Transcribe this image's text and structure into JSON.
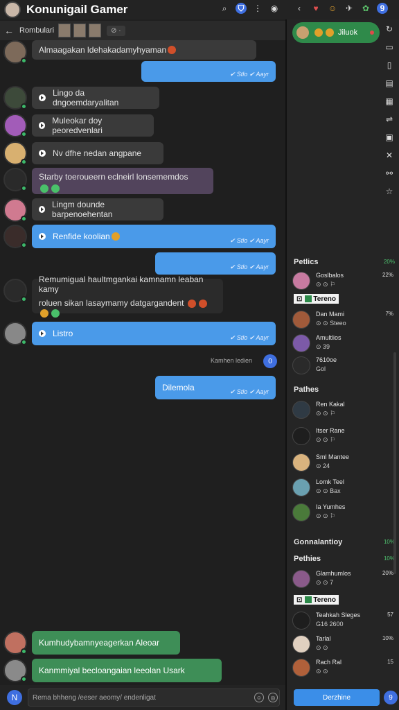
{
  "app": {
    "title": "Konunigail Gamer"
  },
  "topbar_icons": [
    "search-icon",
    "shield-icon",
    "more-icon",
    "profile-icon",
    "back-icon",
    "heart-icon",
    "mask-icon",
    "pin-icon",
    "leaf-icon",
    "badge-icon"
  ],
  "subbar": {
    "back": "←",
    "title": "Rombulari",
    "chip": "⊘ ·"
  },
  "messages": [
    {
      "type": "in",
      "text": "Almaagakan ldehakadamyhyaman"
    },
    {
      "type": "out",
      "text": "",
      "meta": "✔ Stlo  ✔ Aayr"
    },
    {
      "type": "in-voice",
      "text": "Lingo da dngoemdaryalitan"
    },
    {
      "type": "in-voice",
      "text": "Muleokar doy peoredvenlari"
    },
    {
      "type": "in-voice",
      "text": "Nv dfhe  nedan  angpane"
    },
    {
      "type": "in-purple",
      "text": "Starby toeroueern eclneirl  lonsememdos"
    },
    {
      "type": "in-voice",
      "text": "Lingm dounde barpenoehentan"
    },
    {
      "type": "out-voice",
      "text": "Renfide koolian",
      "meta": "✔ Stlo  ✔ Aayr"
    },
    {
      "type": "out",
      "text": "",
      "meta": "✔ Stlo  ✔ Aayr"
    },
    {
      "type": "in-long",
      "line1": "Remumigual haultmgankai kamnamn leaban kamy",
      "line2": "roluen sikan lasaymamy datgargandent"
    },
    {
      "type": "out-voice",
      "text": "Listro",
      "meta": "✔ Stlo  ✔ Aayr"
    },
    {
      "type": "out",
      "text": "Dilemola",
      "meta": "✔ Stlo  ✔ Aayr"
    },
    {
      "type": "in-green",
      "text": "Kumhudybamnyeagerkan  Aleoar"
    },
    {
      "type": "in-green",
      "text": "Kanmmiyal becloangaian  leeolan  Usark"
    }
  ],
  "system": {
    "text": "Kamhen ledien",
    "button": "0"
  },
  "composer": {
    "placeholder": "Rema bhheng /eeser aeomy/ endenligat",
    "plus": "N"
  },
  "right": {
    "active": {
      "label": "Jiluok"
    },
    "sections": [
      {
        "title": "Petlics",
        "count": "20%"
      },
      {
        "title": "Pathes",
        "count": ""
      },
      {
        "title": "Gonnalantioy",
        "count": "10%"
      },
      {
        "title": "Pethies",
        "count": "10%"
      }
    ],
    "members": [
      {
        "name": "Goslbalos",
        "stat": "⊙ ⊙ ⚐",
        "val": "22%"
      },
      {
        "name": "Dan Mami",
        "stat": "⊙ ⊙ Steeo",
        "val": "7%"
      },
      {
        "name": "Amultlios",
        "stat": "⊙ 39",
        "val": ""
      },
      {
        "name": "7610oe",
        "stat": "Gol",
        "val": ""
      },
      {
        "name": "Ren Kakal",
        "stat": "⊙ ⊙ ⚐",
        "val": ""
      },
      {
        "name": "Itser Rane",
        "stat": "⊙ ⊙ ⚐",
        "val": ""
      },
      {
        "name": "Sml Mantee",
        "stat": "⊙ 24",
        "val": ""
      },
      {
        "name": "Lomk Teel",
        "stat": "⊙ ⊙ Bax",
        "val": ""
      },
      {
        "name": "Ia Yumhes",
        "stat": "⊙ ⊙ ⚐",
        "val": ""
      },
      {
        "name": "Glamhumlos",
        "stat": "⊙ ⊙ 7",
        "val": "20%"
      },
      {
        "name": "Teahkah Sleges",
        "stat": "G16 2600",
        "val": "57"
      },
      {
        "name": "Tarlal",
        "stat": "⊙ ⊙",
        "val": "10%"
      },
      {
        "name": "Rach Ral",
        "stat": "⊙ ⊙",
        "val": "15"
      }
    ],
    "tag": "Tereno",
    "tag_prefix": "⊡",
    "bottom_button": "Derzhine",
    "bottom_icon": "9"
  }
}
